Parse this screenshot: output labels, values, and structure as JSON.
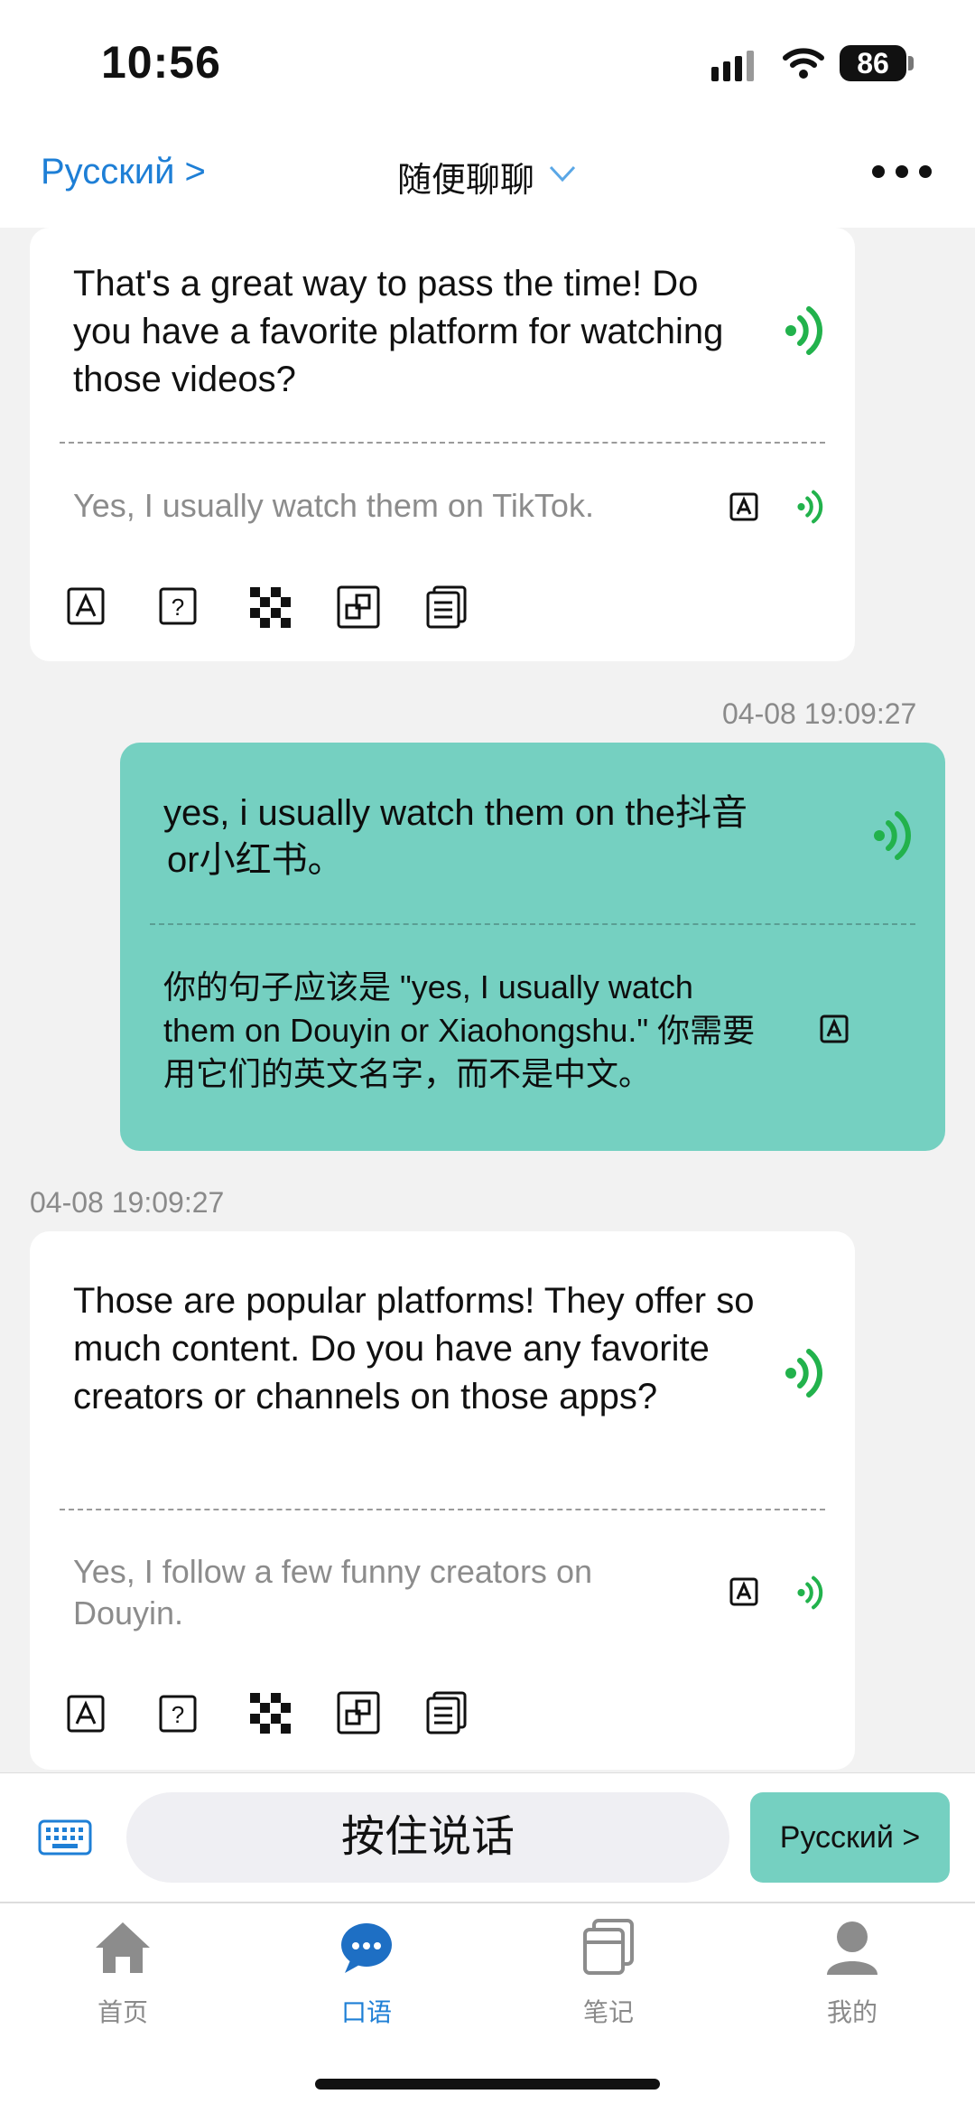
{
  "status_bar": {
    "time": "10:56",
    "battery": "86"
  },
  "nav": {
    "language_link": "Русский >",
    "title": "随便聊聊",
    "more": "more-options"
  },
  "messages": [
    {
      "role": "ai",
      "text": "That's a great way to pass the time! Do you have a favorite platform for watching those videos?",
      "suggestion": "Yes, I usually watch them on TikTok."
    },
    {
      "role": "user",
      "timestamp": "04-08 19:09:27",
      "text_line1": "yes, i usually watch them on the抖音",
      "text_line2": "or小红书。",
      "feedback": "你的句子应该是 \"yes, I usually watch them on Douyin or Xiaohongshu.\" 你需要用它们的英文名字，而不是中文。"
    },
    {
      "role": "ai",
      "timestamp": "04-08 19:09:27",
      "text": "Those are popular platforms! They offer so much content. Do you have any favorite creators or channels on those apps?",
      "suggestion": "Yes, I follow a few funny creators on Douyin."
    }
  ],
  "input": {
    "hold_to_talk": "按住说话",
    "language_button": "Русский >"
  },
  "tabs": [
    {
      "label": "首页",
      "icon": "home-icon",
      "active": false
    },
    {
      "label": "口语",
      "icon": "chat-bubble-icon",
      "active": true
    },
    {
      "label": "笔记",
      "icon": "notes-icon",
      "active": false
    },
    {
      "label": "我的",
      "icon": "profile-icon",
      "active": false
    }
  ],
  "colors": {
    "accent_blue": "#1e7fd6",
    "teal": "#75d0c1",
    "speaker_green": "#22b24c",
    "background": "#f2f2f2"
  }
}
